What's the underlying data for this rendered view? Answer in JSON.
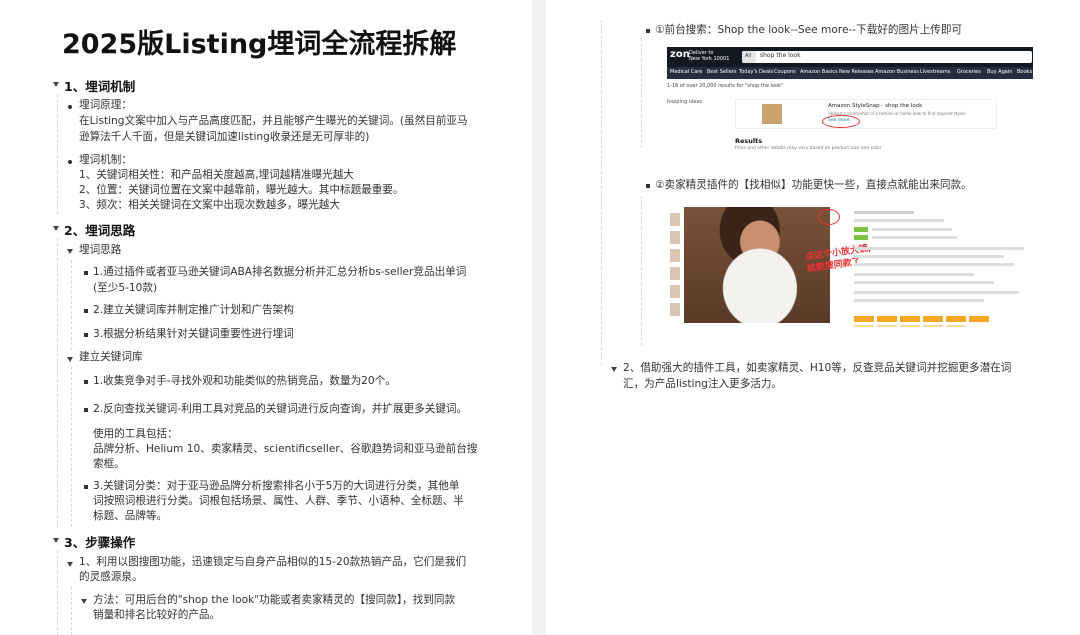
{
  "doc": {
    "title": "2025版Listing埋词全流程拆解",
    "s1": {
      "heading": "1、埋词机制",
      "principle_label": "埋词原理：",
      "principle_l1": "在Listing文案中加入与产品高度匹配，并且能够产生曝光的关键词。(虽然目前亚马",
      "principle_l2": "逊算法千人千面，但是关键词加速listing收录还是无可厚非的)",
      "mech_label": "埋词机制：",
      "mech_1": "1、关键词相关性：和产品相关度越高,埋词越精准曝光越大",
      "mech_2": "2、位置：关键词位置在文案中越靠前，曝光越大。其中标题最重要。",
      "mech_3": "3、频次：相关关键词在文案中出现次数越多，曝光越大"
    },
    "s2": {
      "heading": "2、埋词思路",
      "sub1": "埋词思路",
      "i1_l1": "1.通过插件或者亚马逊关键词ABA排名数据分析并汇总分析bs-seller竞品出单词",
      "i1_l2": "(至少5-10款)",
      "i2": "2.建立关键词库并制定推广计划和广告架构",
      "i3": "3.根据分析结果针对关键词重要性进行埋词",
      "sub2": "建立关键词库",
      "j1": "1.收集竞争对手-寻找外观和功能类似的热销竞品，数量为20个。",
      "j2": "2.反向查找关键词-利用工具对竞品的关键词进行反向查询，并扩展更多关键词。",
      "tools_label": "使用的工具包括：",
      "tools_l1": "品牌分析、Helium 10、卖家精灵、scientificseller、谷歌趋势词和亚马逊前台搜",
      "tools_l2": "索框。",
      "j3_l1": "3.关键词分类：对于亚马逊品牌分析搜索排名小于5万的大词进行分类，其他单",
      "j3_l2": "词按照词根进行分类。词根包括场景、属性、人群、季节、小语种、全标题、半",
      "j3_l3": "标题、品牌等。"
    },
    "s3": {
      "heading": "3、步骤操作",
      "k1_l1": "1、利用以图搜图功能，迅速锁定与自身产品相似的15-20款热销产品，它们是我们",
      "k1_l2": "的灵感源泉。",
      "m_l1": "方法：可用后台的\"shop the look\"功能或者卖家精灵的【搜同款】，找到同款",
      "m_l2": "销量和排名比较好的产品。"
    },
    "right": {
      "r1": "①前台搜索：Shop the look--See more--下载好的图片上传即可",
      "r2": "②卖家精灵插件的【找相似】功能更快一些，直接点就能出来同款。",
      "r3_l1": "2、借助强大的插件工具，如卖家精灵、H10等，反查竞品关键词并挖掘更多潜在词",
      "r3_l2": "汇，为产品listing注入更多活力。"
    },
    "amazon_shot": {
      "logo": "zon",
      "loc_l1": "Deliver to",
      "loc_l2": "New York 10001",
      "search": "shop the look",
      "sel": "All",
      "nav": [
        "Medical Care",
        "Best Sellers",
        "Today's Deals",
        "Coupons",
        "Amazon Basics",
        "New Releases",
        "Amazon Business",
        "Livestreams",
        "Groceries",
        "Buy Again",
        "Books"
      ],
      "results_line": "1-16 of over 20,000 results for \"shop the look\"",
      "side": "hopping Ideas",
      "card_title": "Amazon StyleSnap - shop the look",
      "card_sub": "Upload a screenshot of a fashion or home look to find inspired styles",
      "see_more": "See more",
      "results_h": "Results",
      "results_s": "Price and other details may vary based on product size and color"
    },
    "seller_shot": {
      "annotation_l1": "点这个小放大镜,",
      "annotation_l2": "就能搜同款了"
    }
  }
}
